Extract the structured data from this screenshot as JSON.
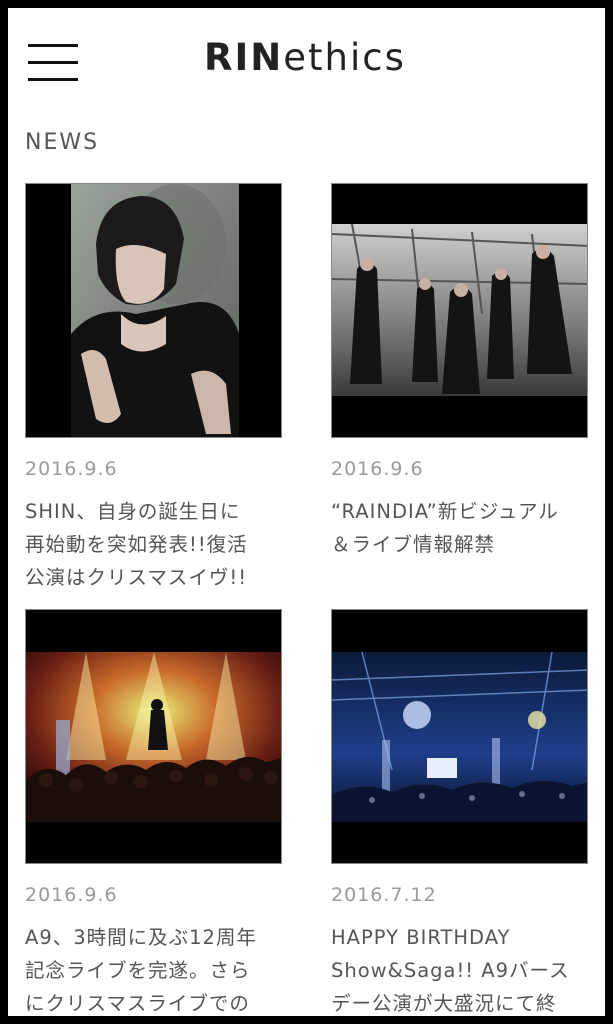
{
  "header": {
    "logo_bold": "RIN",
    "logo_rest": "ethics"
  },
  "section": {
    "title": "NEWS"
  },
  "news": [
    {
      "date": "2016.9.6",
      "lines": [
        "SHIN、自身の誕生日に",
        "再始動を突如発表!!復活",
        "公演はクリスマスイヴ!!"
      ]
    },
    {
      "date": "2016.9.6",
      "lines": [
        "“RAINDIA”新ビジュアル",
        "＆ライブ情報解禁"
      ]
    },
    {
      "date": "2016.9.6",
      "lines": [
        "A9、3時間に及ぶ12周年",
        "記念ライブを完遂。さら",
        "にクリスマスライブでの"
      ]
    },
    {
      "date": "2016.7.12",
      "lines": [
        "HAPPY BIRTHDAY",
        "Show&Saga!! A9バース",
        "デー公演が大盛況にて終"
      ]
    }
  ]
}
